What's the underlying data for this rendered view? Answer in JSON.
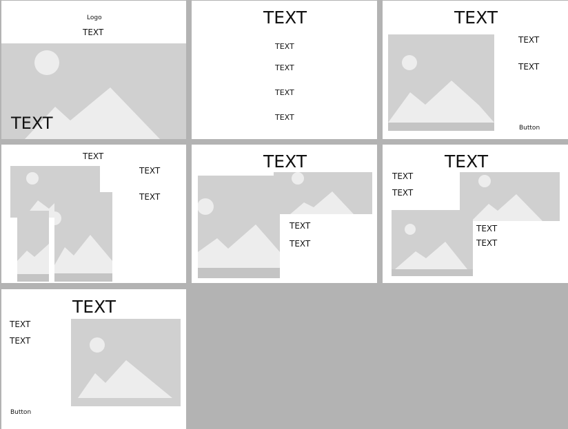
{
  "colors": {
    "background": "#b3b3b3",
    "panel": "#ffffff",
    "placeholder_fill": "#d0d0d0",
    "placeholder_shape": "#ededed",
    "placeholder_band": "#c4c4c4"
  },
  "panel1": {
    "logo": "Logo",
    "heading": "TEXT",
    "hero_text": "TEXT"
  },
  "panel2": {
    "title": "TEXT",
    "items": [
      "TEXT",
      "TEXT",
      "TEXT",
      "TEXT"
    ]
  },
  "panel3": {
    "title": "TEXT",
    "text1": "TEXT",
    "text2": "TEXT",
    "button": "Button"
  },
  "panel4": {
    "title": "TEXT",
    "text1": "TEXT",
    "text2": "TEXT"
  },
  "panel5": {
    "title": "TEXT",
    "text1": "TEXT",
    "text2": "TEXT"
  },
  "panel6": {
    "title": "TEXT",
    "text1": "TEXT",
    "text2": "TEXT",
    "text3": "TEXT",
    "text4": "TEXT"
  },
  "panel7": {
    "title": "TEXT",
    "text1": "TEXT",
    "text2": "TEXT",
    "button": "Button"
  }
}
